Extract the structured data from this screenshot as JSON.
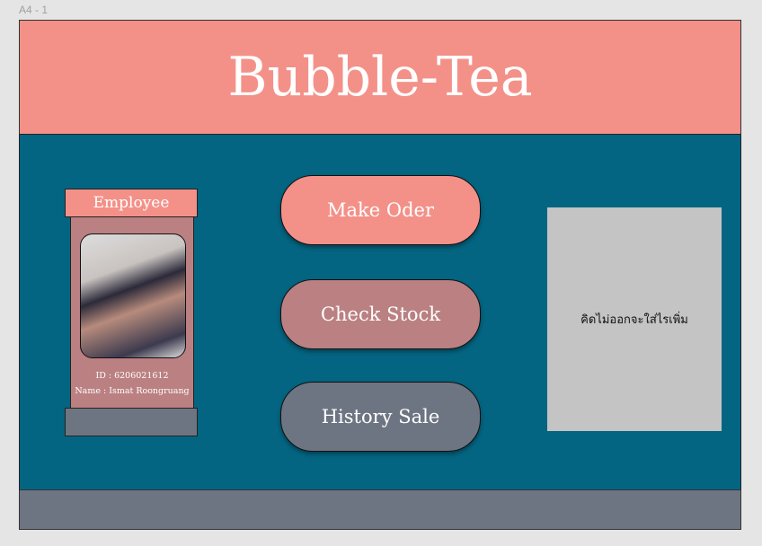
{
  "frame_label": "A4 - 1",
  "header": {
    "title": "Bubble-Tea"
  },
  "employee_card": {
    "title": "Employee",
    "id_text": "ID : 6206021612",
    "name_text": "Name : Ismat Roongruang"
  },
  "buttons": [
    {
      "label": "Make Oder",
      "color": "#f39189"
    },
    {
      "label": "Check Stock",
      "color": "#bb8082"
    },
    {
      "label": "History Sale",
      "color": "#6e7582"
    }
  ],
  "side_box": {
    "text": "คิดไม่ออกจะใส่ไรเพิ่ม"
  }
}
